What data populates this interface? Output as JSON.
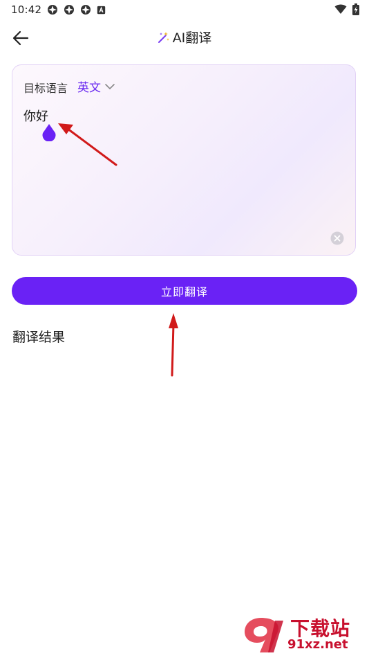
{
  "status_bar": {
    "time": "10:42",
    "left_icons": [
      "notification-app-icon",
      "notification-app-icon",
      "notification-app-icon",
      "keyboard-a-icon"
    ],
    "right_icons": [
      "wifi-icon",
      "battery-charging-icon"
    ]
  },
  "app_bar": {
    "back_icon": "arrow-left-icon",
    "title_icon": "magic-wand-sparkle-icon",
    "title": "AI翻译"
  },
  "input_card": {
    "target_language_label": "目标语言",
    "target_language_value": "英文",
    "source_text": "你好",
    "clear_icon": "clear-circle-icon"
  },
  "translate_button": {
    "label": "立即翻译"
  },
  "result": {
    "heading": "翻译结果"
  },
  "watermark": {
    "text_top": "下载站",
    "text_bottom": "91xz.net"
  },
  "colors": {
    "accent": "#6a22f5",
    "language_value": "#6b2bf0",
    "annotation_arrow": "#d11a1a",
    "watermark": "#c8102e"
  }
}
